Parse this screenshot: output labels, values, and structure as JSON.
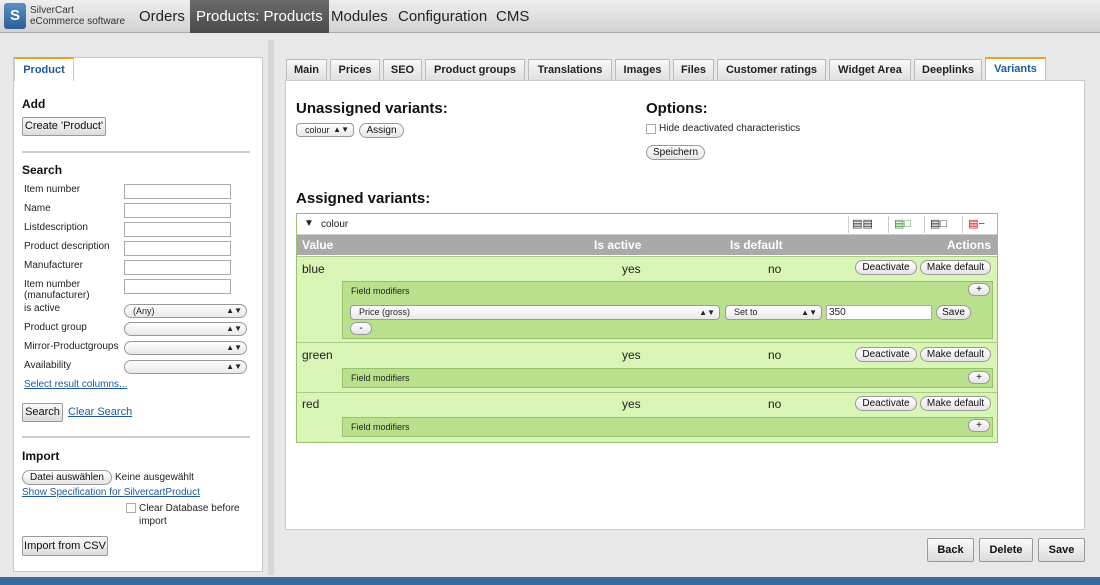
{
  "app": {
    "logo_line1": "SilverCart",
    "logo_line2": "eCommerce software",
    "logo_mark": "S"
  },
  "nav": {
    "items": [
      "Orders",
      "Products: Products",
      "Modules",
      "Configuration",
      "CMS"
    ]
  },
  "left": {
    "tab": "Product",
    "add_heading": "Add",
    "create_button": "Create 'Product'",
    "search_heading": "Search",
    "fields": [
      "Item number",
      "Name",
      "Listdescription",
      "Product description",
      "Manufacturer"
    ],
    "item_number_manufacturer": "Item number (manufacturer)",
    "is_active": "is active",
    "is_active_value": "(Any)",
    "product_group": "Product group",
    "mirror_groups": "Mirror-Productgroups",
    "availability": "Availability",
    "select_columns": "Select result columns...",
    "search_button": "Search",
    "clear_search": "Clear Search",
    "import_heading": "Import",
    "choose_file": "Datei auswählen",
    "no_file": "Keine ausgewählt",
    "spec_link": "Show Specification for SilvercartProduct",
    "clear_db": "Clear Database before import",
    "import_button": "Import from CSV"
  },
  "tabs": [
    "Main",
    "Prices",
    "SEO",
    "Product groups",
    "Translations",
    "Images",
    "Files",
    "Customer ratings",
    "Widget Area",
    "Deeplinks",
    "Variants"
  ],
  "main": {
    "unassigned_heading": "Unassigned variants:",
    "unassigned_select": "colour",
    "assign_button": "Assign",
    "options_heading": "Options:",
    "hide_deactivated": "Hide deactivated characteristics",
    "save_options": "Speichern",
    "assigned_heading": "Assigned variants:",
    "group_name": "colour",
    "columns": {
      "value": "Value",
      "active": "Is active",
      "default": "Is default",
      "actions": "Actions"
    },
    "rows": [
      {
        "value": "blue",
        "active": "yes",
        "default": "no"
      },
      {
        "value": "green",
        "active": "yes",
        "default": "no"
      },
      {
        "value": "red",
        "active": "yes",
        "default": "no"
      }
    ],
    "deactivate": "Deactivate",
    "make_default": "Make default",
    "field_modifiers": "Field modifiers",
    "modifier_field": "Price (gross)",
    "modifier_action": "Set to",
    "modifier_value": "350",
    "modifier_save": "Save",
    "plus": "+",
    "minus": "-"
  },
  "actions": {
    "back": "Back",
    "delete": "Delete",
    "save": "Save"
  }
}
